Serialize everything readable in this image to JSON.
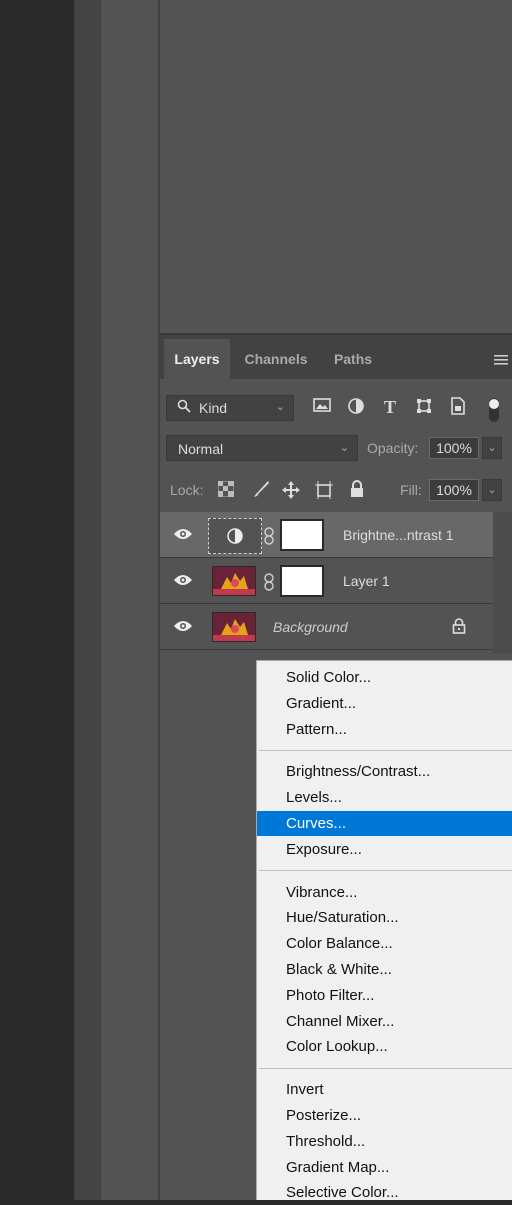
{
  "tabs": [
    "Layers",
    "Channels",
    "Paths"
  ],
  "filter": {
    "kind_label": "Kind",
    "icons": [
      "image-icon",
      "adjustment-icon",
      "type-icon",
      "shape-icon",
      "smart-object-icon",
      "filter-toggle-icon"
    ]
  },
  "blend": {
    "mode": "Normal",
    "opacity_label": "Opacity:",
    "opacity_value": "100%"
  },
  "lock": {
    "label": "Lock:",
    "fill_label": "Fill:",
    "fill_value": "100%"
  },
  "layers": [
    {
      "name": "Brightne...ntrast 1",
      "selected": true
    },
    {
      "name": "Layer 1",
      "selected": false
    },
    {
      "name": "Background",
      "selected": false
    }
  ],
  "menu": {
    "groups": [
      [
        "Solid Color...",
        "Gradient...",
        "Pattern..."
      ],
      [
        "Brightness/Contrast...",
        "Levels...",
        "Curves...",
        "Exposure..."
      ],
      [
        "Vibrance...",
        "Hue/Saturation...",
        "Color Balance...",
        "Black & White...",
        "Photo Filter...",
        "Channel Mixer...",
        "Color Lookup..."
      ],
      [
        "Invert",
        "Posterize...",
        "Threshold...",
        "Gradient Map...",
        "Selective Color..."
      ]
    ],
    "highlighted": "Curves...",
    "highlight_color": "#0078d7"
  }
}
